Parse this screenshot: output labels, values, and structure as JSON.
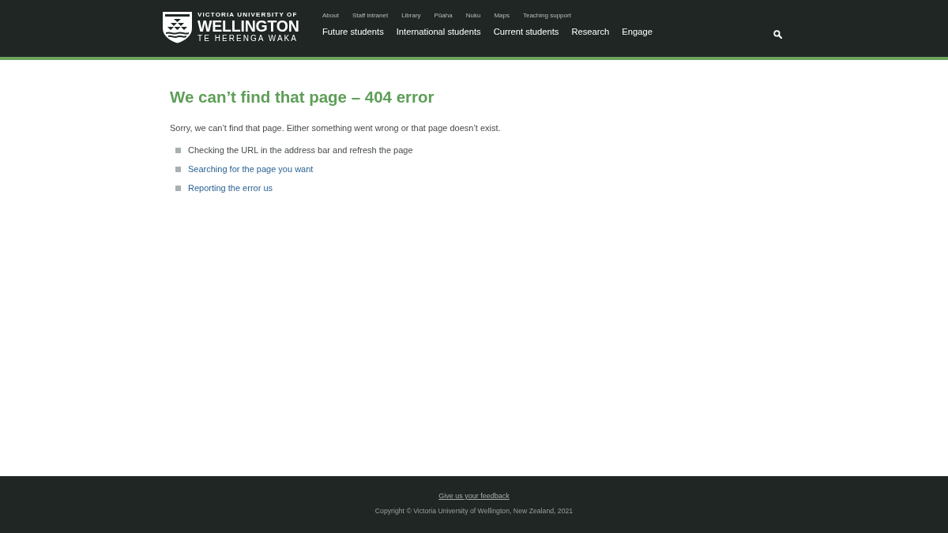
{
  "header": {
    "logo": {
      "line_1": "VICTORIA UNIVERSITY OF",
      "line_2": "WELLINGTON",
      "line_3": "TE HERENGA WAKA"
    },
    "utility_links": [
      "About",
      "Staff intranet",
      "Library",
      "Pūaha",
      "Nuku",
      "Maps",
      "Teaching support"
    ],
    "main_nav": [
      "Future students",
      "International students",
      "Current students",
      "Research",
      "Engage"
    ]
  },
  "content": {
    "heading": "We can’t find that page – 404 error",
    "intro": "Sorry, we can’t find that page. Either something went wrong or that page doesn’t exist.",
    "suggestions": [
      {
        "kind": "text",
        "text": "Checking the URL in the address bar and refresh the page"
      },
      {
        "kind": "link",
        "text": "Searching for the page you want"
      },
      {
        "kind": "link",
        "text": "Reporting the error us"
      }
    ]
  },
  "footer": {
    "feedback_link": "Give us your feedback",
    "copyright": "Copyright © Victoria University of Wellington, New Zealand, 2021"
  }
}
